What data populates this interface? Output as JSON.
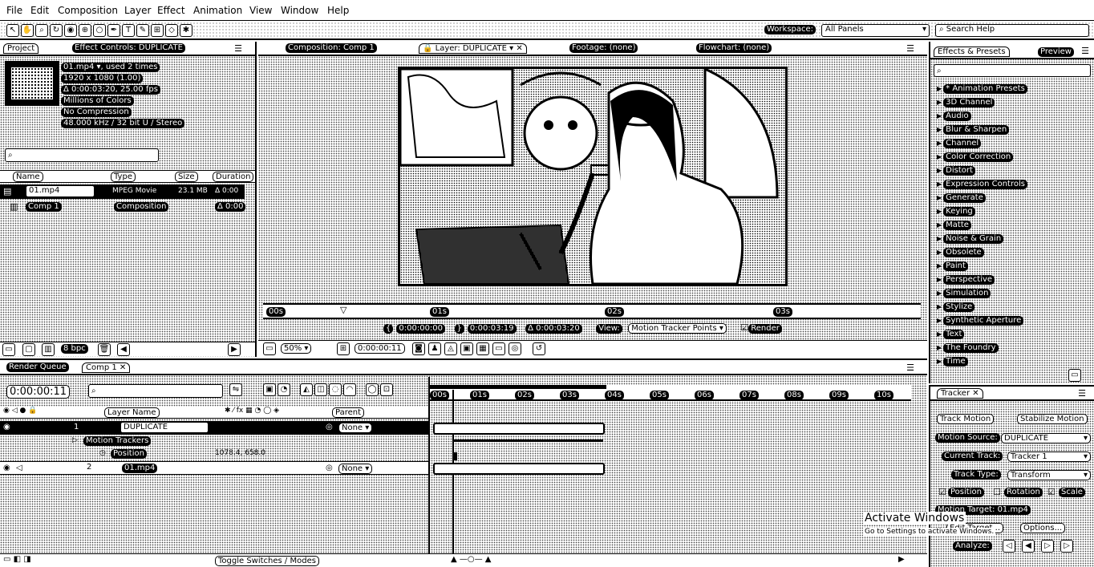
{
  "menu": [
    "File",
    "Edit",
    "Composition",
    "Layer",
    "Effect",
    "Animation",
    "View",
    "Window",
    "Help"
  ],
  "toolbar": {
    "workspace_label": "Workspace:",
    "workspace_value": "All Panels",
    "search_placeholder": "Search Help"
  },
  "project_panel": {
    "tabs": [
      "Project",
      "Effect Controls: DUPLICATE"
    ],
    "footage_info": [
      "01.mp4 ▾, used 2 times",
      "1920 x 1080 (1.00)",
      "Δ 0:00:03:20, 25.00 fps",
      "Millions of Colors",
      "No Compression",
      "48.000 kHz / 32 bit U / Stereo"
    ],
    "columns": [
      "Name",
      "Type",
      "Size",
      "Duration"
    ],
    "items": [
      {
        "name": "01.mp4",
        "type": "MPEG Movie",
        "size": "23.1 MB",
        "duration": "Δ 0:00"
      },
      {
        "name": "Comp 1",
        "type": "Composition",
        "size": "",
        "duration": "Δ 0:00"
      }
    ],
    "bpc": "8 bpc"
  },
  "viewer": {
    "tabs": [
      "Composition: Comp 1",
      "Layer: DUPLICATE",
      "Footage: (none)",
      "Flowchart: (none)"
    ],
    "ruler_labels": [
      "00s",
      "01s",
      "02s",
      "03s"
    ],
    "in_time": "0:00:00:00",
    "out_time": "0:00:03:19",
    "duration": "Δ 0:00:03:20",
    "view_label": "View:",
    "view_value": "Motion Tracker Points",
    "render_label": "Render",
    "zoom": "50%",
    "current_time": "0:00:00:11"
  },
  "effects_panel": {
    "tabs": [
      "Effects & Presets",
      "Preview"
    ],
    "items": [
      "* Animation Presets",
      "3D Channel",
      "Audio",
      "Blur & Sharpen",
      "Channel",
      "Color Correction",
      "Distort",
      "Expression Controls",
      "Generate",
      "Keying",
      "Matte",
      "Noise & Grain",
      "Obsolete",
      "Paint",
      "Perspective",
      "Simulation",
      "Stylize",
      "Synthetic Aperture",
      "Text",
      "The Foundry",
      "Time"
    ]
  },
  "timeline": {
    "tabs": [
      "Render Queue",
      "Comp 1"
    ],
    "current_time": "0:00:00:11",
    "columns": [
      "Layer Name",
      "Parent"
    ],
    "layers": [
      {
        "num": "1",
        "name": "DUPLICATE",
        "parent": "None"
      },
      {
        "num": "",
        "name": "Motion Trackers",
        "parent": ""
      },
      {
        "num": "",
        "name": "Position",
        "parent": "",
        "value": "1078.4, 658.0"
      },
      {
        "num": "2",
        "name": "01.mp4",
        "parent": "None"
      }
    ],
    "ruler": [
      "00s",
      "01s",
      "02s",
      "03s",
      "04s",
      "05s",
      "06s",
      "07s",
      "08s",
      "09s",
      "10s"
    ],
    "toggle_label": "Toggle Switches / Modes"
  },
  "tracker": {
    "tab": "Tracker",
    "track_motion": "Track Motion",
    "stabilize_motion": "Stabilize Motion",
    "motion_source_label": "Motion Source:",
    "motion_source": "DUPLICATE",
    "current_track_label": "Current Track:",
    "current_track": "Tracker 1",
    "track_type_label": "Track Type:",
    "track_type": "Transform",
    "position": "Position",
    "rotation": "Rotation",
    "scale": "Scale",
    "motion_target": "Motion Target: 01.mp4",
    "edit_target": "Edit Target...",
    "options": "Options...",
    "analyze": "Analyze:",
    "watermark1": "Activate Windows",
    "watermark2": "Go to Settings to activate Windows."
  }
}
